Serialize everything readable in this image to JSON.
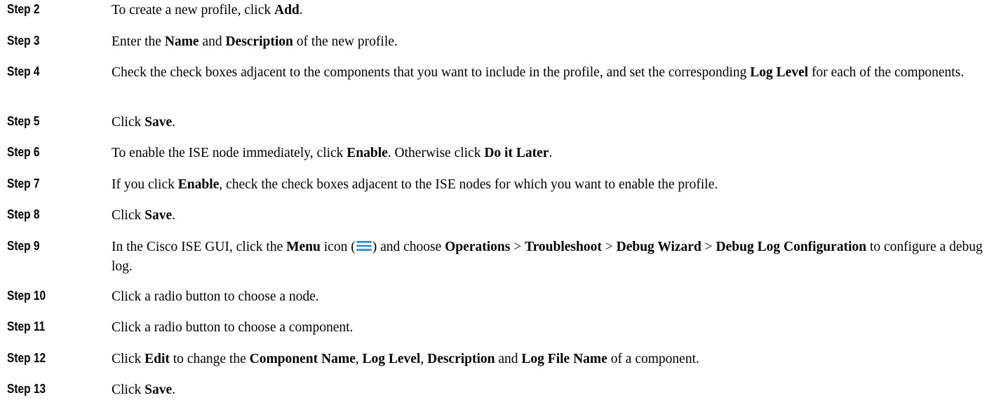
{
  "steps": [
    {
      "label": "Step 2",
      "t1": "To create a new profile, click ",
      "b1": "Add",
      "t2": "."
    },
    {
      "label": "Step 3",
      "t1": "Enter the ",
      "b1": "Name",
      "t2": " and ",
      "b2": "Description",
      "t3": " of the new profile."
    },
    {
      "label": "Step 4",
      "t1": "Check the check boxes adjacent to the components that you want to include in the profile, and set the corresponding ",
      "b1": "Log Level",
      "t2": " for each of the components."
    },
    {
      "label": "Step 5",
      "t1": "Click ",
      "b1": "Save",
      "t2": "."
    },
    {
      "label": "Step 6",
      "t1": "To enable the ISE node immediately, click ",
      "b1": "Enable",
      "t2": ". Otherwise click ",
      "b2": "Do it Later",
      "t3": "."
    },
    {
      "label": "Step 7",
      "t1": "If you click ",
      "b1": "Enable",
      "t2": ", check the check boxes adjacent to the ISE nodes for which you want to enable the profile."
    },
    {
      "label": "Step 8",
      "t1": "Click ",
      "b1": "Save",
      "t2": "."
    },
    {
      "label": "Step 9",
      "t1": "In the Cisco ISE GUI, click the ",
      "b1": "Menu",
      "t2": " icon (",
      "icon": "hamburger-menu-icon",
      "t3": ") and choose ",
      "b2": "Operations",
      "t4": " > ",
      "b3": "Troubleshoot",
      "t5": " > ",
      "b4": "Debug Wizard",
      "t6": " > ",
      "b5": "Debug Log Configuration",
      "t7": " to configure a debug log."
    },
    {
      "label": "Step 10",
      "t1": "Click a radio button to choose a node."
    },
    {
      "label": "Step 11",
      "t1": "Click a radio button to choose a component."
    },
    {
      "label": "Step 12",
      "t1": "Click ",
      "b1": "Edit",
      "t2": " to change the ",
      "b2": "Component Name",
      "t3": ", ",
      "b3": "Log Level",
      "t4": ", ",
      "b4": "Description",
      "t5": " and ",
      "b5": "Log File Name",
      "t6": " of a component."
    },
    {
      "label": "Step 13",
      "t1": "Click ",
      "b1": "Save",
      "t2": "."
    }
  ],
  "colors": {
    "text": "#000000",
    "menu_icon": "#1f8ad6"
  }
}
